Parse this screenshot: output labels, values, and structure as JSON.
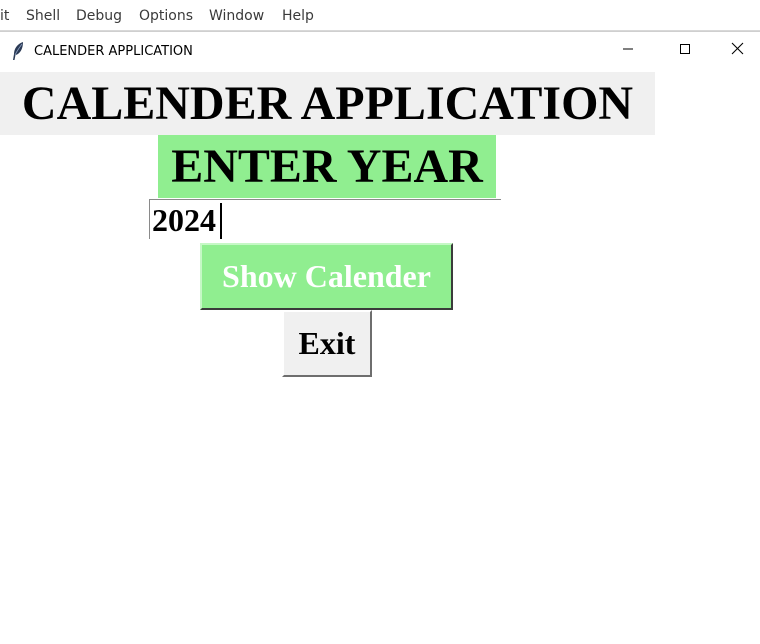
{
  "menubar": {
    "items": [
      "it",
      "Shell",
      "Debug",
      "Options",
      "Window",
      "Help"
    ]
  },
  "window": {
    "title": "CALENDER APPLICATION",
    "icon": "feather-icon",
    "controls": [
      "minimize-icon",
      "maximize-icon",
      "close-icon"
    ]
  },
  "main": {
    "heading": "CALENDER APPLICATION",
    "enter_label": "ENTER YEAR",
    "year_value": "2024",
    "show_button_label": "Show Calender",
    "exit_button_label": "Exit"
  },
  "colors": {
    "accent_green": "#90ee90",
    "button_grey": "#f0f0f0"
  }
}
